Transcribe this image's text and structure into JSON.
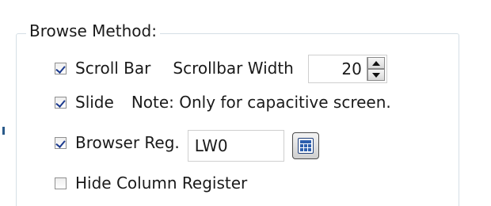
{
  "group": {
    "title": "Browse Method:"
  },
  "options": {
    "scroll_bar": {
      "label": "Scroll Bar",
      "checked": true,
      "width_label": "Scrollbar Width",
      "width_value": "20"
    },
    "slide": {
      "label": "Slide",
      "checked": true,
      "note": "Note: Only for capacitive screen."
    },
    "browser_reg": {
      "label": "Browser Reg.",
      "checked": true,
      "value": "LW0"
    },
    "hide_column_register": {
      "label": "Hide Column Register",
      "checked": false
    }
  },
  "icons": {
    "spin_up": "spin-up-icon",
    "spin_down": "spin-down-icon",
    "register_picker": "calculator-icon"
  }
}
